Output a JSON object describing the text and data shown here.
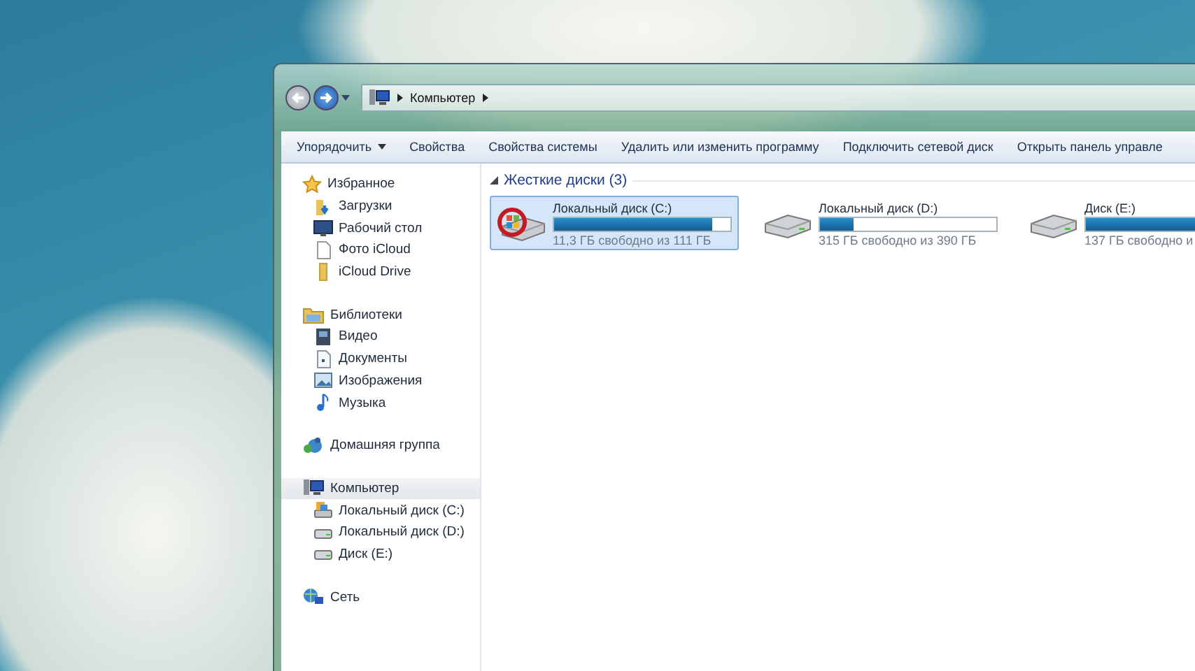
{
  "address_bar": {
    "path": [
      "Компьютер"
    ]
  },
  "toolbar": [
    {
      "label": "Упорядочить",
      "dropdown": true
    },
    {
      "label": "Свойства",
      "dropdown": false
    },
    {
      "label": "Свойства системы",
      "dropdown": false
    },
    {
      "label": "Удалить или изменить программу",
      "dropdown": false
    },
    {
      "label": "Подключить сетевой диск",
      "dropdown": false
    },
    {
      "label": "Открыть панель управле",
      "dropdown": false
    }
  ],
  "sidebar": [
    {
      "label": "Избранное",
      "kind": "star",
      "selected": false,
      "children": [
        {
          "label": "Загрузки",
          "kind": "downloads",
          "selected": false
        },
        {
          "label": "Рабочий стол",
          "kind": "desktop",
          "selected": false
        },
        {
          "label": "Фото iCloud",
          "kind": "file",
          "selected": false
        },
        {
          "label": "iCloud Drive",
          "kind": "folder",
          "selected": false
        }
      ]
    },
    {
      "label": "Библиотеки",
      "kind": "library",
      "selected": false,
      "children": [
        {
          "label": "Видео",
          "kind": "video",
          "selected": false
        },
        {
          "label": "Документы",
          "kind": "document",
          "selected": false
        },
        {
          "label": "Изображения",
          "kind": "image",
          "selected": false
        },
        {
          "label": "Музыка",
          "kind": "music",
          "selected": false
        }
      ]
    },
    {
      "label": "Домашняя группа",
      "kind": "homegroup",
      "selected": false
    },
    {
      "label": "Компьютер",
      "kind": "computer",
      "selected": true,
      "children": [
        {
          "label": "Локальный диск (C:)",
          "kind": "system-drive",
          "selected": false
        },
        {
          "label": "Локальный диск (D:)",
          "kind": "drive",
          "selected": false
        },
        {
          "label": "Диск (E:)",
          "kind": "drive",
          "selected": false
        }
      ]
    },
    {
      "label": "Сеть",
      "kind": "network",
      "selected": false
    }
  ],
  "section": {
    "title": "Жесткие диски (3)",
    "expanded": true
  },
  "drives": [
    {
      "name": "Локальный диск (C:)",
      "free": "11,3 ГБ свободно из 111 ГБ",
      "level": 0.9,
      "kind": "system",
      "selected": true
    },
    {
      "name": "Локальный диск (D:)",
      "free": "315 ГБ свободно из 390 ГБ",
      "level": 0.19,
      "kind": "local",
      "selected": false
    },
    {
      "name": "Диск (E:)",
      "free": "137 ГБ свободно и",
      "level": 0.65,
      "kind": "local",
      "selected": false
    }
  ]
}
